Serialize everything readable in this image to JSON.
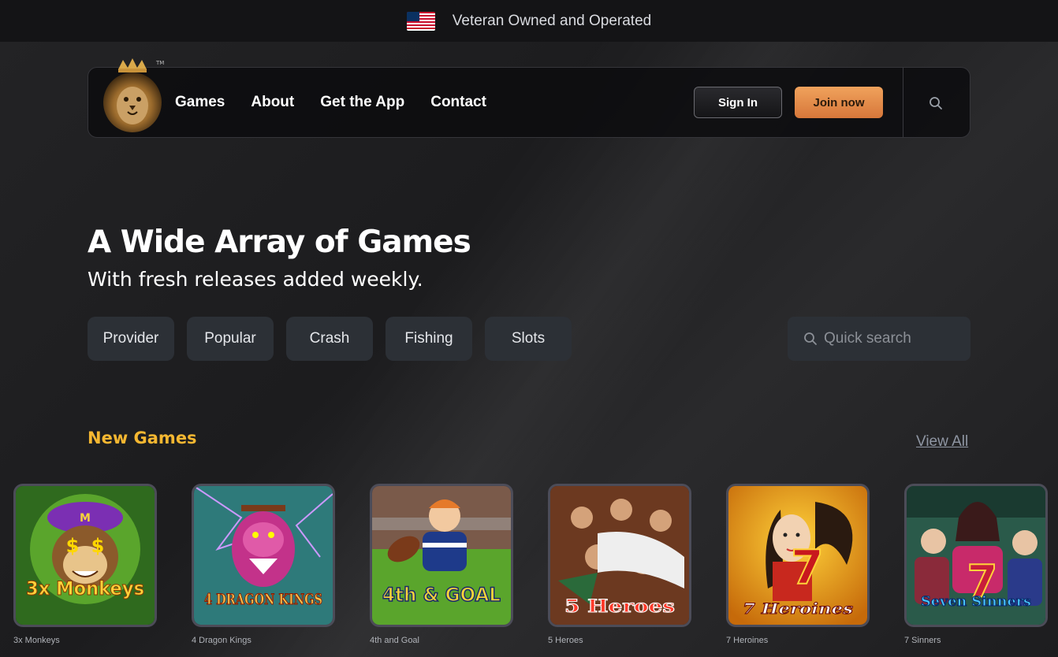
{
  "topbar": {
    "text": "Veteran Owned and Operated",
    "flag": "us-flag-icon"
  },
  "header": {
    "nav": [
      "Games",
      "About",
      "Get the App",
      "Contact"
    ],
    "signin_label": "Sign In",
    "join_label": "Join now",
    "search_icon": "search-icon"
  },
  "hero": {
    "title": "A Wide Array of Games",
    "subtitle": "With fresh releases added weekly."
  },
  "filters": [
    "Provider",
    "Popular",
    "Crash",
    "Fishing",
    "Slots"
  ],
  "quick_search": {
    "placeholder": "Quick search"
  },
  "new_games": {
    "title": "New Games",
    "view_all": "View All",
    "games": [
      {
        "name": "3x Monkeys",
        "art_title": "3x Monkeys"
      },
      {
        "name": "4 Dragon Kings",
        "art_title": "4 DRAGON KINGS"
      },
      {
        "name": "4th and Goal",
        "art_title": "4th & GOAL"
      },
      {
        "name": "5 Heroes",
        "art_title": "5 Heroes"
      },
      {
        "name": "7 Heroines",
        "art_title": "7 Heroines"
      },
      {
        "name": "7 Sinners",
        "art_title": "Seven Sinners"
      }
    ]
  },
  "colors": {
    "accent_gold": "#f5b731",
    "join_button": "#e78b48",
    "chip_bg": "#2c3036",
    "page_bg": "#1b1b1d"
  }
}
